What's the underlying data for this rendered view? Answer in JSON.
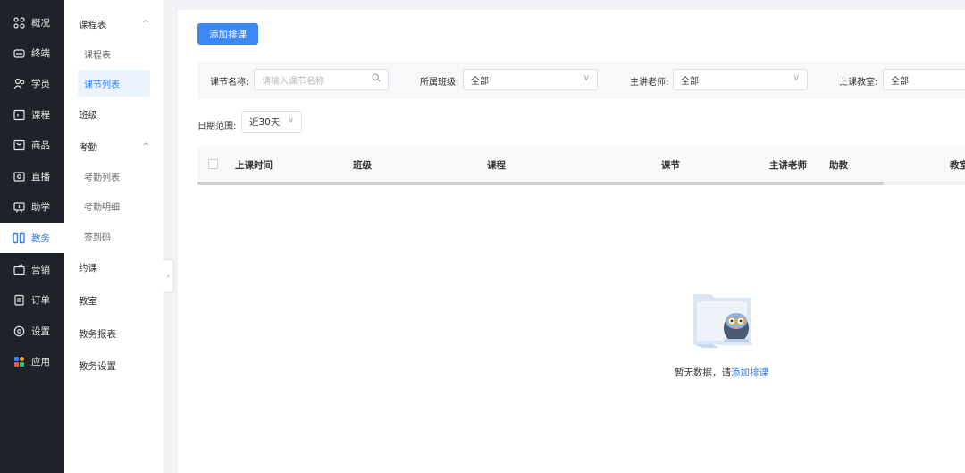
{
  "rail": {
    "items": [
      {
        "label": "概况",
        "icon": "overview-icon"
      },
      {
        "label": "终端",
        "icon": "terminal-icon"
      },
      {
        "label": "学员",
        "icon": "students-icon"
      },
      {
        "label": "课程",
        "icon": "course-icon"
      },
      {
        "label": "商品",
        "icon": "goods-icon"
      },
      {
        "label": "直播",
        "icon": "live-icon"
      },
      {
        "label": "助学",
        "icon": "assist-icon"
      },
      {
        "label": "教务",
        "icon": "academic-icon"
      },
      {
        "label": "营销",
        "icon": "marketing-icon"
      },
      {
        "label": "订单",
        "icon": "order-icon"
      },
      {
        "label": "设置",
        "icon": "settings-icon"
      },
      {
        "label": "应用",
        "icon": "apps-icon"
      }
    ],
    "active_index": 7,
    "colors": {
      "background": "#1f2329",
      "active_text": "#2f7cf6"
    }
  },
  "submenu": {
    "items": [
      {
        "label": "课程表",
        "type": "group",
        "arrow": "^"
      },
      {
        "label": "课程表",
        "type": "child"
      },
      {
        "label": "课节列表",
        "type": "child",
        "active": true
      },
      {
        "label": "班级",
        "type": "item"
      },
      {
        "label": "考勤",
        "type": "group",
        "arrow": "^"
      },
      {
        "label": "考勤列表",
        "type": "child"
      },
      {
        "label": "考勤明细",
        "type": "child"
      },
      {
        "label": "签到码",
        "type": "child"
      },
      {
        "label": "约课",
        "type": "item"
      },
      {
        "label": "教室",
        "type": "item"
      },
      {
        "label": "教务报表",
        "type": "item"
      },
      {
        "label": "教务设置",
        "type": "item"
      }
    ],
    "collapse_glyph": "‹"
  },
  "toolbar": {
    "add_schedule_label": "添加排课"
  },
  "filters": {
    "lesson_name_label": "课节名称:",
    "lesson_name_placeholder": "请输入课节名称",
    "class_label": "所属班级:",
    "class_value": "全部",
    "teacher_label": "主讲老师:",
    "teacher_value": "全部",
    "classroom_label": "上课教室:",
    "classroom_value": "全部",
    "date_label": "日期范围:",
    "date_value": "近30天"
  },
  "table": {
    "columns": [
      "上课时间",
      "班级",
      "课程",
      "课节",
      "主讲老师",
      "助教",
      "教室"
    ],
    "rows": []
  },
  "empty": {
    "text": "暂无数据，请",
    "link": "添加排课"
  },
  "accent": "#3d87f5"
}
